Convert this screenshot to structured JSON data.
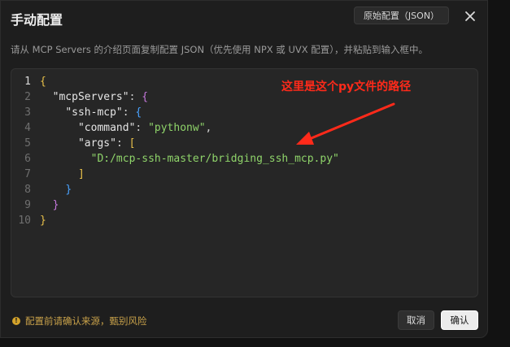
{
  "dialog": {
    "title": "手动配置",
    "raw_button": "原始配置（JSON）",
    "subtitle": "请从 MCP Servers 的介绍页面复制配置 JSON（优先使用 NPX 或 UVX 配置），并粘贴到输入框中。"
  },
  "editor": {
    "line_numbers": [
      "1",
      "2",
      "3",
      "4",
      "5",
      "6",
      "7",
      "8",
      "9",
      "10"
    ],
    "lines": [
      [
        {
          "t": "{",
          "c": "brace-y"
        }
      ],
      [
        {
          "t": "  "
        },
        {
          "t": "\"mcpServers\"",
          "c": "key"
        },
        {
          "t": ": ",
          "c": "punc"
        },
        {
          "t": "{",
          "c": "brace-p"
        }
      ],
      [
        {
          "t": "    "
        },
        {
          "t": "\"ssh-mcp\"",
          "c": "key"
        },
        {
          "t": ": ",
          "c": "punc"
        },
        {
          "t": "{",
          "c": "brace-b"
        }
      ],
      [
        {
          "t": "      "
        },
        {
          "t": "\"command\"",
          "c": "key"
        },
        {
          "t": ": ",
          "c": "punc"
        },
        {
          "t": "\"pythonw\"",
          "c": "str"
        },
        {
          "t": ",",
          "c": "punc"
        }
      ],
      [
        {
          "t": "      "
        },
        {
          "t": "\"args\"",
          "c": "key"
        },
        {
          "t": ": ",
          "c": "punc"
        },
        {
          "t": "[",
          "c": "brace-y"
        }
      ],
      [
        {
          "t": "        "
        },
        {
          "t": "\"D:/mcp-ssh-master/bridging_ssh_mcp.py\"",
          "c": "str"
        }
      ],
      [
        {
          "t": "      "
        },
        {
          "t": "]",
          "c": "brace-y"
        }
      ],
      [
        {
          "t": "    "
        },
        {
          "t": "}",
          "c": "brace-b"
        }
      ],
      [
        {
          "t": "  "
        },
        {
          "t": "}",
          "c": "brace-p"
        }
      ],
      [
        {
          "t": "}",
          "c": "brace-y"
        }
      ]
    ]
  },
  "annotation": {
    "text": "这里是这个py文件的路径",
    "color": "#ff2a1a"
  },
  "footer": {
    "note": "配置前请确认来源，甄别风险",
    "cancel": "取消",
    "confirm": "确认"
  },
  "icons": {
    "close": "close-icon",
    "warning": "warning-icon"
  }
}
